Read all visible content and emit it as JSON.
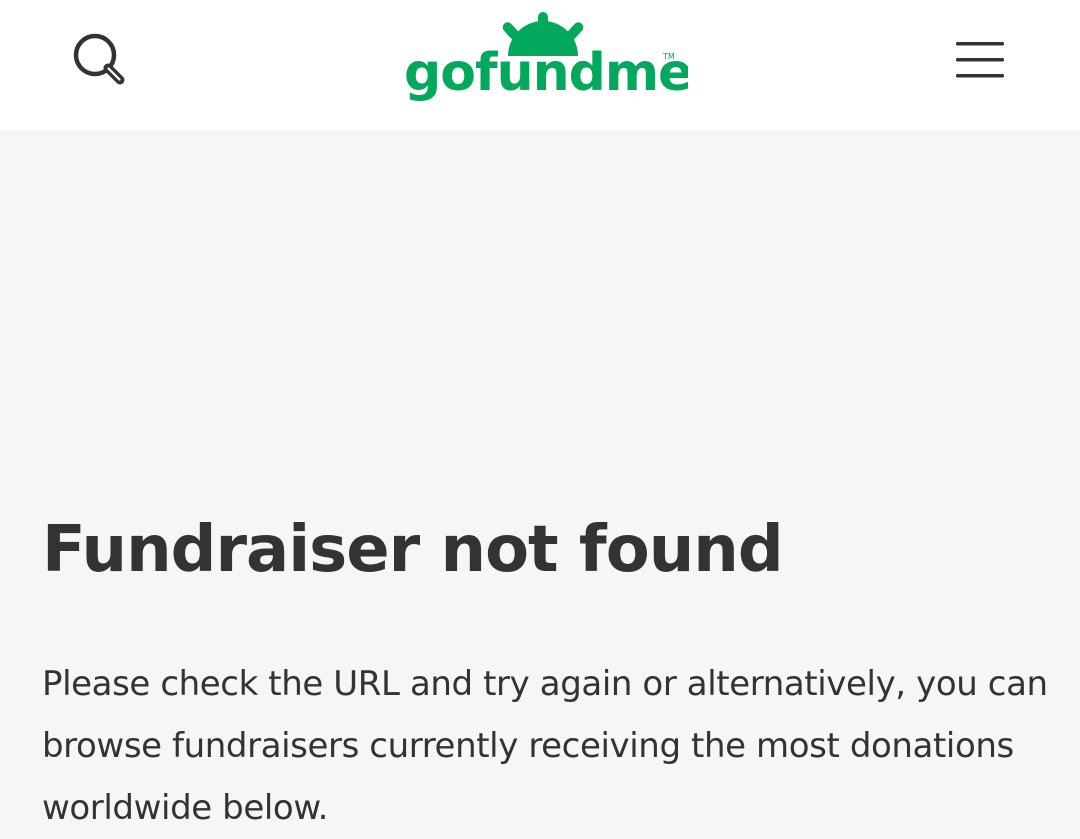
{
  "header": {
    "logo_text": "gofundme",
    "logo_trademark": "TM",
    "search_icon": "search-icon",
    "menu_icon": "hamburger-menu-icon",
    "brand_color": "#02a95c"
  },
  "main": {
    "title": "Fundraiser not found",
    "message": "Please check the URL and try again or alternatively, you can browse fundraisers currently receiving the most donations worldwide below."
  },
  "colors": {
    "header_background": "#ffffff",
    "page_background": "#f6f6f6",
    "text": "#333333"
  }
}
